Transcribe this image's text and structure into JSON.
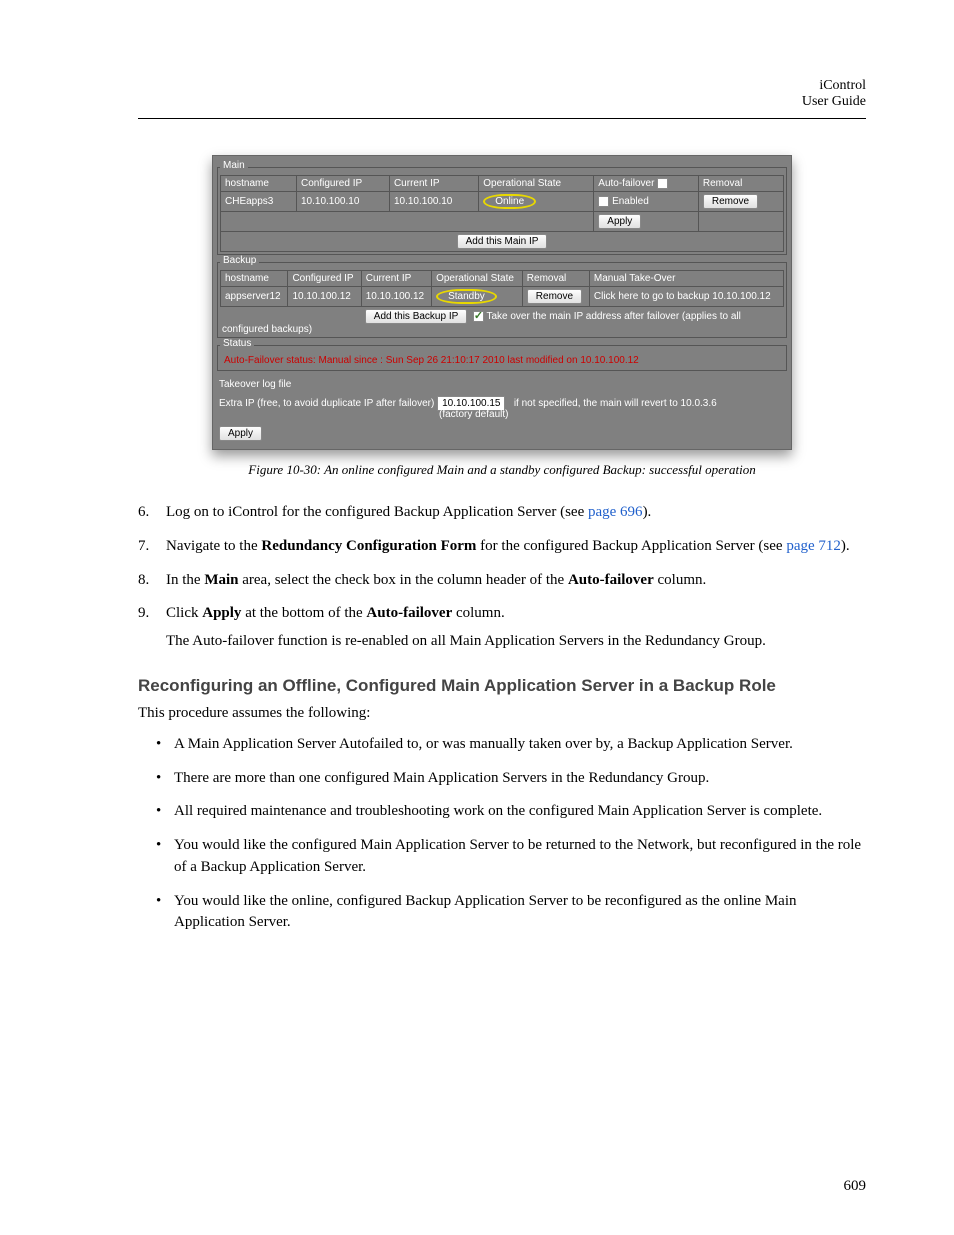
{
  "header": {
    "title": "iControl",
    "subtitle": "User Guide"
  },
  "figure": {
    "main": {
      "legend": "Main",
      "headers": [
        "hostname",
        "Configured IP",
        "Current IP",
        "Operational State",
        "Auto-failover",
        "Removal"
      ],
      "row": {
        "hostname": "CHEapps3",
        "configured_ip": "10.10.100.10",
        "current_ip": "10.10.100.10",
        "state": "Online",
        "enabled": "Enabled",
        "remove": "Remove"
      },
      "apply": "Apply",
      "add_btn": "Add this Main IP"
    },
    "backup": {
      "legend": "Backup",
      "headers": [
        "hostname",
        "Configured IP",
        "Current IP",
        "Operational State",
        "Removal",
        "Manual Take-Over"
      ],
      "row": {
        "hostname": "appserver12",
        "configured_ip": "10.10.100.12",
        "current_ip": "10.10.100.12",
        "state": "Standby",
        "remove": "Remove",
        "takeover": "Click here to go to backup 10.10.100.12"
      },
      "add_btn": "Add this Backup IP",
      "takeover_note": "Take over the main IP address after failover (applies to all configured backups)"
    },
    "status": {
      "legend": "Status",
      "text": "Auto-Failover status: Manual since : Sun Sep 26 21:10:17 2010 last modified on 10.10.100.12"
    },
    "log_label": "Takeover log file",
    "extra_ip_label": "Extra IP (free, to avoid duplicate IP after failover)",
    "extra_ip_value": "10.10.100.15",
    "factory_default": "(factory default)",
    "extra_ip_note": "if not specified, the main will revert to 10.0.3.6",
    "apply_btn": "Apply"
  },
  "caption": "Figure 10-30:  An online configured Main and a standby configured Backup: successful operation",
  "steps": {
    "s6": {
      "num": "6.",
      "t1": "Log on to iControl for the configured Backup Application Server (see ",
      "link": "page 696",
      "t2": ")."
    },
    "s7": {
      "num": "7.",
      "t1": "Navigate to the ",
      "bold": "Redundancy Configuration Form",
      "t2": " for the configured Backup Application Server (see ",
      "link": "page 712",
      "t3": ")."
    },
    "s8": {
      "num": "8.",
      "t1": "In the ",
      "b1": "Main",
      "t2": " area, select the check box in the column header of the ",
      "b2": "Auto-failover",
      "t3": " column."
    },
    "s9": {
      "num": "9.",
      "t1": "Click ",
      "b1": "Apply",
      "t2": " at the bottom of the ",
      "b2": "Auto-failover",
      "t3": " column.",
      "sub": "The Auto-failover function is re-enabled on all Main Application Servers in the Redundancy Group."
    }
  },
  "section_heading": "Reconfiguring an Offline, Configured Main Application Server in a Backup Role",
  "intro": "This procedure assumes the following:",
  "bullets": {
    "b1": "A Main Application Server Autofailed to, or was manually taken over by, a Backup Application Server.",
    "b2": "There are more than one configured Main Application Servers in the Redundancy Group.",
    "b3": "All required maintenance and troubleshooting work on the configured Main Application Server is complete.",
    "b4": "You would like the configured Main Application Server to be returned to the Network, but reconfigured in the role of a Backup Application Server.",
    "b5": "You would like the online, configured Backup Application Server to be reconfigured as the online Main Application Server."
  },
  "pagenum": "609"
}
